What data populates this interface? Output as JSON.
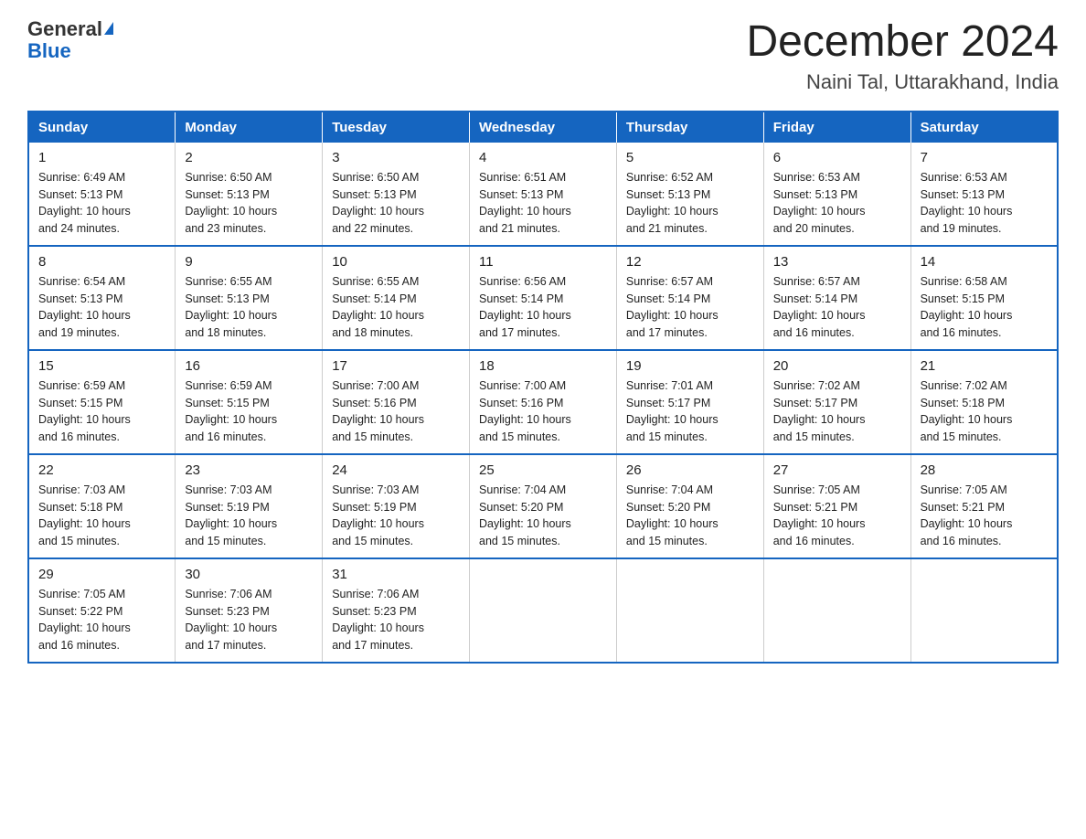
{
  "header": {
    "logo_general": "General",
    "logo_blue": "Blue",
    "month_title": "December 2024",
    "location": "Naini Tal, Uttarakhand, India"
  },
  "days_of_week": [
    "Sunday",
    "Monday",
    "Tuesday",
    "Wednesday",
    "Thursday",
    "Friday",
    "Saturday"
  ],
  "weeks": [
    [
      {
        "day": "1",
        "sunrise": "6:49 AM",
        "sunset": "5:13 PM",
        "daylight": "10 hours and 24 minutes."
      },
      {
        "day": "2",
        "sunrise": "6:50 AM",
        "sunset": "5:13 PM",
        "daylight": "10 hours and 23 minutes."
      },
      {
        "day": "3",
        "sunrise": "6:50 AM",
        "sunset": "5:13 PM",
        "daylight": "10 hours and 22 minutes."
      },
      {
        "day": "4",
        "sunrise": "6:51 AM",
        "sunset": "5:13 PM",
        "daylight": "10 hours and 21 minutes."
      },
      {
        "day": "5",
        "sunrise": "6:52 AM",
        "sunset": "5:13 PM",
        "daylight": "10 hours and 21 minutes."
      },
      {
        "day": "6",
        "sunrise": "6:53 AM",
        "sunset": "5:13 PM",
        "daylight": "10 hours and 20 minutes."
      },
      {
        "day": "7",
        "sunrise": "6:53 AM",
        "sunset": "5:13 PM",
        "daylight": "10 hours and 19 minutes."
      }
    ],
    [
      {
        "day": "8",
        "sunrise": "6:54 AM",
        "sunset": "5:13 PM",
        "daylight": "10 hours and 19 minutes."
      },
      {
        "day": "9",
        "sunrise": "6:55 AM",
        "sunset": "5:13 PM",
        "daylight": "10 hours and 18 minutes."
      },
      {
        "day": "10",
        "sunrise": "6:55 AM",
        "sunset": "5:14 PM",
        "daylight": "10 hours and 18 minutes."
      },
      {
        "day": "11",
        "sunrise": "6:56 AM",
        "sunset": "5:14 PM",
        "daylight": "10 hours and 17 minutes."
      },
      {
        "day": "12",
        "sunrise": "6:57 AM",
        "sunset": "5:14 PM",
        "daylight": "10 hours and 17 minutes."
      },
      {
        "day": "13",
        "sunrise": "6:57 AM",
        "sunset": "5:14 PM",
        "daylight": "10 hours and 16 minutes."
      },
      {
        "day": "14",
        "sunrise": "6:58 AM",
        "sunset": "5:15 PM",
        "daylight": "10 hours and 16 minutes."
      }
    ],
    [
      {
        "day": "15",
        "sunrise": "6:59 AM",
        "sunset": "5:15 PM",
        "daylight": "10 hours and 16 minutes."
      },
      {
        "day": "16",
        "sunrise": "6:59 AM",
        "sunset": "5:15 PM",
        "daylight": "10 hours and 16 minutes."
      },
      {
        "day": "17",
        "sunrise": "7:00 AM",
        "sunset": "5:16 PM",
        "daylight": "10 hours and 15 minutes."
      },
      {
        "day": "18",
        "sunrise": "7:00 AM",
        "sunset": "5:16 PM",
        "daylight": "10 hours and 15 minutes."
      },
      {
        "day": "19",
        "sunrise": "7:01 AM",
        "sunset": "5:17 PM",
        "daylight": "10 hours and 15 minutes."
      },
      {
        "day": "20",
        "sunrise": "7:02 AM",
        "sunset": "5:17 PM",
        "daylight": "10 hours and 15 minutes."
      },
      {
        "day": "21",
        "sunrise": "7:02 AM",
        "sunset": "5:18 PM",
        "daylight": "10 hours and 15 minutes."
      }
    ],
    [
      {
        "day": "22",
        "sunrise": "7:03 AM",
        "sunset": "5:18 PM",
        "daylight": "10 hours and 15 minutes."
      },
      {
        "day": "23",
        "sunrise": "7:03 AM",
        "sunset": "5:19 PM",
        "daylight": "10 hours and 15 minutes."
      },
      {
        "day": "24",
        "sunrise": "7:03 AM",
        "sunset": "5:19 PM",
        "daylight": "10 hours and 15 minutes."
      },
      {
        "day": "25",
        "sunrise": "7:04 AM",
        "sunset": "5:20 PM",
        "daylight": "10 hours and 15 minutes."
      },
      {
        "day": "26",
        "sunrise": "7:04 AM",
        "sunset": "5:20 PM",
        "daylight": "10 hours and 15 minutes."
      },
      {
        "day": "27",
        "sunrise": "7:05 AM",
        "sunset": "5:21 PM",
        "daylight": "10 hours and 16 minutes."
      },
      {
        "day": "28",
        "sunrise": "7:05 AM",
        "sunset": "5:21 PM",
        "daylight": "10 hours and 16 minutes."
      }
    ],
    [
      {
        "day": "29",
        "sunrise": "7:05 AM",
        "sunset": "5:22 PM",
        "daylight": "10 hours and 16 minutes."
      },
      {
        "day": "30",
        "sunrise": "7:06 AM",
        "sunset": "5:23 PM",
        "daylight": "10 hours and 17 minutes."
      },
      {
        "day": "31",
        "sunrise": "7:06 AM",
        "sunset": "5:23 PM",
        "daylight": "10 hours and 17 minutes."
      },
      null,
      null,
      null,
      null
    ]
  ],
  "labels": {
    "sunrise": "Sunrise:",
    "sunset": "Sunset:",
    "daylight": "Daylight:"
  }
}
